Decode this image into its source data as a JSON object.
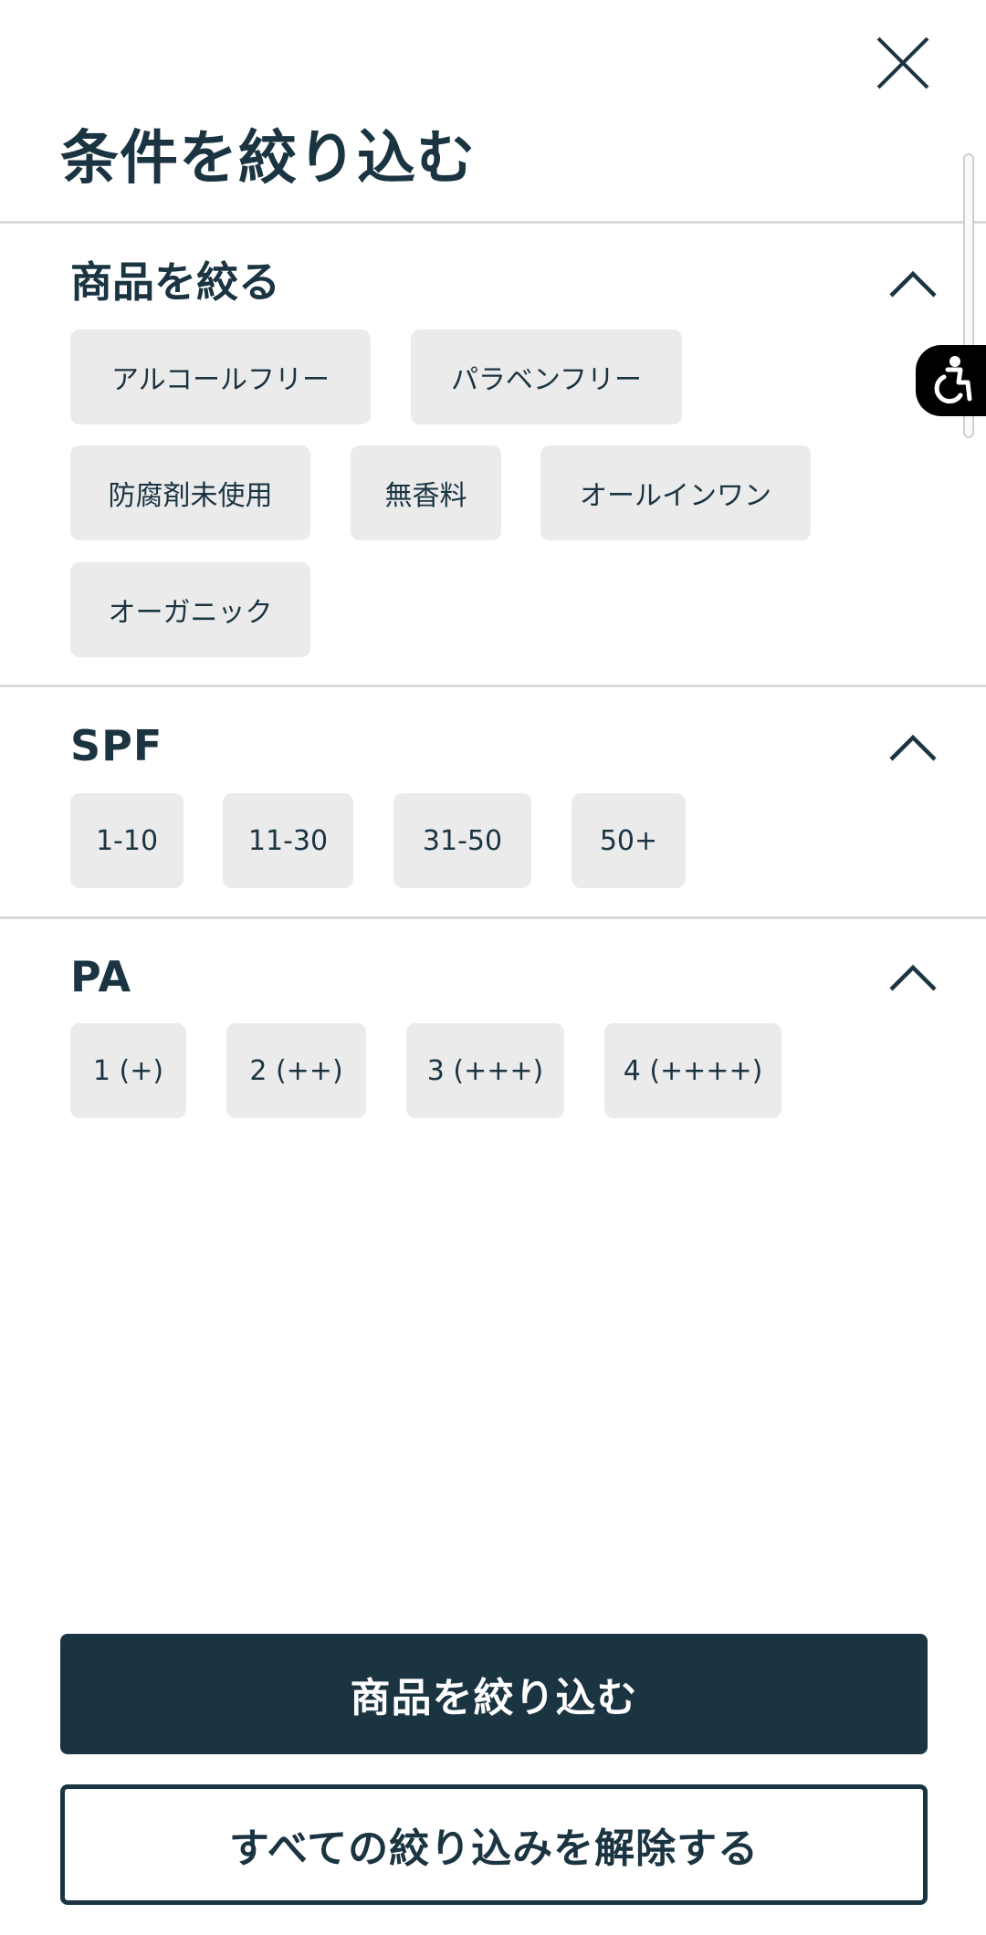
{
  "header": {
    "close_icon": "close-icon",
    "title": "条件を絞り込む"
  },
  "sections": [
    {
      "title": "商品を絞る",
      "toggle_icon": "chevron-up-icon",
      "options": [
        "アルコールフリー",
        "パラベンフリー",
        "防腐剤未使用",
        "無香料",
        "オールインワン",
        "オーガニック"
      ]
    },
    {
      "title": "SPF",
      "toggle_icon": "chevron-up-icon",
      "options": [
        "1-10",
        "11-30",
        "31-50",
        "50+"
      ]
    },
    {
      "title": "PA",
      "toggle_icon": "chevron-up-icon",
      "options": [
        "1 (+)",
        "2 (++)",
        "3 (+++)",
        "4 (++++)"
      ]
    }
  ],
  "accessibility_widget": {
    "icon": "accessibility-icon"
  },
  "actions": {
    "apply_label": "商品を絞り込む",
    "clear_label": "すべての絞り込みを解除する"
  },
  "colors": {
    "primary": "#1b3442",
    "chip_bg": "#ebebeb",
    "divider": "#d9d9d9",
    "background": "#ffffff"
  }
}
